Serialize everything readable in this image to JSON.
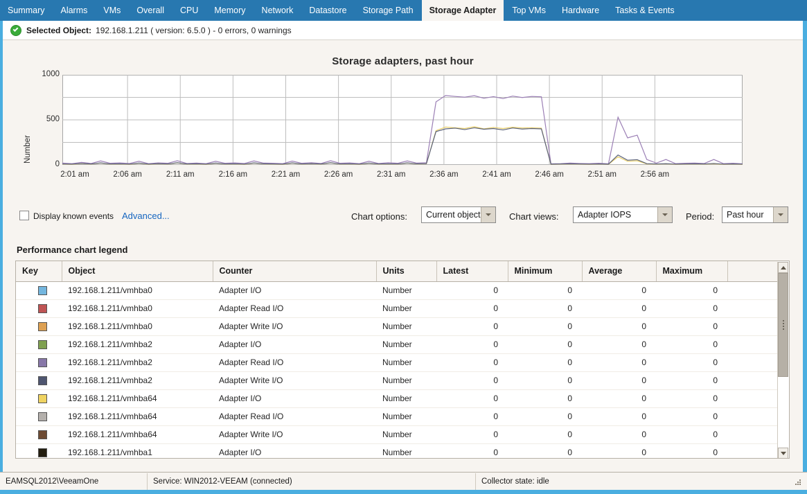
{
  "tabs": [
    {
      "label": "Summary",
      "active": false
    },
    {
      "label": "Alarms",
      "active": false
    },
    {
      "label": "VMs",
      "active": false
    },
    {
      "label": "Overall",
      "active": false
    },
    {
      "label": "CPU",
      "active": false
    },
    {
      "label": "Memory",
      "active": false
    },
    {
      "label": "Network",
      "active": false
    },
    {
      "label": "Datastore",
      "active": false
    },
    {
      "label": "Storage Path",
      "active": false
    },
    {
      "label": "Storage Adapter",
      "active": true
    },
    {
      "label": "Top VMs",
      "active": false
    },
    {
      "label": "Hardware",
      "active": false
    },
    {
      "label": "Tasks & Events",
      "active": false
    }
  ],
  "selected_object": {
    "icon": "ok-check-icon",
    "label": "Selected Object:",
    "value": "192.168.1.211 ( version: 6.5.0 ) - 0 errors, 0 warnings"
  },
  "options": {
    "display_known_events_label": "Display known events",
    "display_known_events_checked": false,
    "advanced_link": "Advanced...",
    "chart_options_label": "Chart options:",
    "chart_options_value": "Current object",
    "chart_views_label": "Chart views:",
    "chart_views_value": "Adapter IOPS",
    "period_label": "Period:",
    "period_value": "Past hour"
  },
  "legend": {
    "title": "Performance chart legend",
    "columns": [
      "Key",
      "Object",
      "Counter",
      "Units",
      "Latest",
      "Minimum",
      "Average",
      "Maximum",
      ""
    ],
    "rows": [
      {
        "color": "#74b6de",
        "object": "192.168.1.211/vmhba0",
        "counter": "Adapter I/O",
        "units": "Number",
        "latest": "0",
        "minimum": "0",
        "average": "0",
        "maximum": "0"
      },
      {
        "color": "#bf5454",
        "object": "192.168.1.211/vmhba0",
        "counter": "Adapter Read I/O",
        "units": "Number",
        "latest": "0",
        "minimum": "0",
        "average": "0",
        "maximum": "0"
      },
      {
        "color": "#dda košt",
        "object": "",
        "counter": "",
        "units": "",
        "latest": "",
        "minimum": "",
        "average": "",
        "maximum": ""
      },
      {
        "color": "#7fa050",
        "object": "192.168.1.211/vmhba2",
        "counter": "Adapter I/O",
        "units": "Number",
        "latest": "0",
        "minimum": "0",
        "average": "0",
        "maximum": "0"
      },
      {
        "color": "#8777a8",
        "object": "192.168.1.211/vmhba2",
        "counter": "Adapter Read I/O",
        "units": "Number",
        "latest": "0",
        "minimum": "0",
        "average": "0",
        "maximum": "0"
      },
      {
        "color": "#4f5670",
        "object": "192.168.1.211/vmhba2",
        "counter": "Adapter Write I/O",
        "units": "Number",
        "latest": "0",
        "minimum": "0",
        "average": "0",
        "maximum": "0"
      },
      {
        "color": "#efd361",
        "object": "192.168.1.211/vmhba64",
        "counter": "Adapter I/O",
        "units": "Number",
        "latest": "0",
        "minimum": "0",
        "average": "0",
        "maximum": "0"
      },
      {
        "color": "#b4b0ac",
        "object": "192.168.1.211/vmhba64",
        "counter": "Adapter Read I/O",
        "units": "Number",
        "latest": "0",
        "minimum": "0",
        "average": "0",
        "maximum": "0"
      },
      {
        "color": "#6d4b33",
        "object": "192.168.1.211/vmhba64",
        "counter": "Adapter Write I/O",
        "units": "Number",
        "latest": "0",
        "minimum": "0",
        "average": "0",
        "maximum": "0"
      },
      {
        "color": "#231e10",
        "object": "192.168.1.211/vmhba1",
        "counter": "Adapter I/O",
        "units": "Number",
        "latest": "0",
        "minimum": "0",
        "average": "0",
        "maximum": "0"
      }
    ]
  },
  "statusbar": {
    "database": "EAMSQL2012\\VeeamOne",
    "service": "Service: WIN2012-VEEAM (connected)",
    "collector": "Collector state:  idle"
  },
  "chart_data": {
    "type": "line",
    "title": "Storage adapters, past hour",
    "xlabel": "",
    "ylabel": "Number",
    "ylim": [
      0,
      1000
    ],
    "yticks": [
      0,
      500,
      1000
    ],
    "ygridlines": [
      0,
      250,
      500,
      750,
      1000
    ],
    "grid": true,
    "legend_position": "below-table",
    "xtick_labels": [
      "2:01 am",
      "2:06 am",
      "2:11 am",
      "2:16 am",
      "2:21 am",
      "2:26 am",
      "2:31 am",
      "2:36 am",
      "2:41 am",
      "2:46 am",
      "2:51 am",
      "2:56 am"
    ],
    "x_start_minute": 0,
    "x_end_minute": 60,
    "series": [
      {
        "name": "192.168.1.211/vmhba2 Adapter I/O",
        "color": "#9b7fb5",
        "values": [
          20,
          14,
          28,
          16,
          44,
          18,
          22,
          16,
          40,
          14,
          22,
          18,
          46,
          16,
          20,
          14,
          40,
          18,
          22,
          16,
          44,
          20,
          18,
          14,
          42,
          18,
          24,
          16,
          46,
          18,
          22,
          14,
          40,
          16,
          24,
          18,
          44,
          20,
          24,
          700,
          770,
          760,
          752,
          768,
          740,
          758,
          736,
          764,
          748,
          760,
          756,
          12,
          14,
          20,
          16,
          14,
          18,
          12,
          530,
          300,
          330,
          60,
          20,
          60,
          14,
          18,
          20,
          16,
          60,
          14,
          18,
          12
        ]
      },
      {
        "name": "192.168.1.211/vmhba64 Adapter I/O",
        "color": "#e8cf6a",
        "values": [
          8,
          6,
          14,
          8,
          20,
          8,
          10,
          6,
          18,
          6,
          12,
          8,
          22,
          8,
          10,
          6,
          18,
          8,
          10,
          6,
          20,
          10,
          8,
          6,
          20,
          8,
          12,
          8,
          22,
          8,
          10,
          6,
          18,
          8,
          10,
          8,
          20,
          10,
          12,
          380,
          420,
          412,
          404,
          424,
          400,
          416,
          404,
          418,
          410,
          412,
          408,
          6,
          8,
          10,
          8,
          6,
          8,
          6,
          90,
          40,
          46,
          10,
          8,
          12,
          6,
          8,
          10,
          8,
          12,
          6,
          8,
          6
        ]
      },
      {
        "name": "192.168.1.211/vmhba2 Adapter Write I/O",
        "color": "#5a6179",
        "values": [
          10,
          8,
          16,
          10,
          22,
          10,
          12,
          8,
          20,
          8,
          14,
          10,
          24,
          10,
          12,
          8,
          20,
          10,
          12,
          8,
          22,
          12,
          10,
          8,
          22,
          10,
          14,
          10,
          24,
          10,
          12,
          8,
          20,
          10,
          12,
          10,
          22,
          12,
          14,
          370,
          400,
          408,
          392,
          412,
          396,
          404,
          388,
          410,
          398,
          404,
          400,
          8,
          10,
          12,
          10,
          8,
          10,
          8,
          110,
          52,
          58,
          14,
          10,
          14,
          8,
          10,
          12,
          10,
          16,
          8,
          10,
          8
        ]
      }
    ]
  }
}
